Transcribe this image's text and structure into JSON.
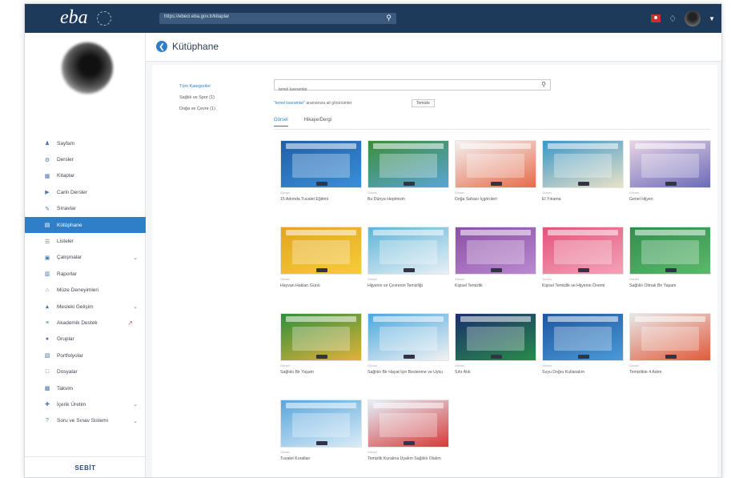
{
  "topbar": {
    "logo": "eba",
    "url": "https://ebeci.eba.gov.tr/kitaplar",
    "icons": [
      "flag-icon",
      "bell-icon",
      "avatar",
      "caret-down-icon"
    ]
  },
  "page": {
    "title": "Kütüphane"
  },
  "sidebar": {
    "items": [
      {
        "label": "Sayfam",
        "icon": "person-icon"
      },
      {
        "label": "Dersler",
        "icon": "gear-icon"
      },
      {
        "label": "Kitaplar",
        "icon": "grid-icon"
      },
      {
        "label": "Canlı Dersler",
        "icon": "video-icon"
      },
      {
        "label": "Sınavlar",
        "icon": "pencil-icon"
      },
      {
        "label": "Kütüphane",
        "icon": "book-icon",
        "active": true
      },
      {
        "label": "Listeler",
        "icon": "list-icon"
      },
      {
        "label": "Çalışmalar",
        "icon": "briefcase-icon",
        "chevron": true
      },
      {
        "label": "Raporlar",
        "icon": "chart-icon"
      },
      {
        "label": "Müze Deneyimleri",
        "icon": "museum-icon"
      },
      {
        "label": "Mesleki Gelişim",
        "icon": "graduation-icon",
        "chevron": true
      },
      {
        "label": "Akademik Destek",
        "icon": "bar-icon",
        "external": true
      },
      {
        "label": "Gruplar",
        "icon": "group-icon"
      },
      {
        "label": "Portfolyolar",
        "icon": "portfolio-icon"
      },
      {
        "label": "Dosyalar",
        "icon": "folder-icon"
      },
      {
        "label": "Takvim",
        "icon": "calendar-icon"
      },
      {
        "label": "İçerik Üretim",
        "icon": "create-icon",
        "chevron": true
      },
      {
        "label": "Soru ve Sınav Sistemi",
        "icon": "question-icon",
        "chevron": true
      }
    ],
    "footer": "SEBİT"
  },
  "categories": {
    "heading": "Tüm Kategoriler",
    "items": [
      "Sağlık ve Spor (1)",
      "Doğa ve Çevre (1)"
    ]
  },
  "search": {
    "value": "temel kavramlar",
    "result_prefix": "\"temel kavramlar\"",
    "result_suffix": "aramanıza ait görünümler",
    "clear_label": "Temizle"
  },
  "tabs": [
    {
      "label": "Görsel",
      "active": true
    },
    {
      "label": "Hikaye/Dergi",
      "active": false
    }
  ],
  "cards": [
    {
      "sub": "Görsel",
      "title": "15 Adımda Tuvalet Eğitimi",
      "c1": "#1f5fa8",
      "c2": "#3a8fd8"
    },
    {
      "sub": "Görsel",
      "title": "Bu Dünya Hepimizin",
      "c1": "#3b8e3a",
      "c2": "#5aa5d6"
    },
    {
      "sub": "Görsel",
      "title": "Doğa Sahası İçgörüleri",
      "c1": "#f2f2f2",
      "c2": "#e76b4a"
    },
    {
      "sub": "Görsel",
      "title": "El Yıkama",
      "c1": "#3a96c9",
      "c2": "#e9e2c8"
    },
    {
      "sub": "Görsel",
      "title": "Genel Hijyen",
      "c1": "#e8d3e6",
      "c2": "#6b6bb8"
    },
    {
      "sub": "Görsel",
      "title": "Hayvan Hakları Günü",
      "c1": "#e3a51e",
      "c2": "#f6cc3a"
    },
    {
      "sub": "Görsel",
      "title": "Hijyenin ve Çevrenin Temizliği",
      "c1": "#5fb4d8",
      "c2": "#e8f1f6"
    },
    {
      "sub": "Görsel",
      "title": "Kişisel Temizlik",
      "c1": "#8b4fa5",
      "c2": "#b98ad0"
    },
    {
      "sub": "Görsel",
      "title": "Kişisel Temizlik ve Hijyenin Önemi",
      "c1": "#e5537a",
      "c2": "#f2a3b8"
    },
    {
      "sub": "Görsel",
      "title": "Sağlıklı Olmak Bir Yaşam",
      "c1": "#2e8f4e",
      "c2": "#5cb86a"
    },
    {
      "sub": "Görsel",
      "title": "Sağlıklı Bir Yaşam",
      "c1": "#2f8f3a",
      "c2": "#e2b23a"
    },
    {
      "sub": "Görsel",
      "title": "Sağlıklı Bir Hayat İçin Beslenme ve Uyku",
      "c1": "#4aa8df",
      "c2": "#f2f2f2"
    },
    {
      "sub": "Görsel",
      "title": "Sıfır Atık",
      "c1": "#1a2f6e",
      "c2": "#2a8a4a"
    },
    {
      "sub": "Görsel",
      "title": "Suyu Doğru Kullanalım",
      "c1": "#1e56a0",
      "c2": "#4a9ad8"
    },
    {
      "sub": "Görsel",
      "title": "Temizlikte 4 Adım",
      "c1": "#e7e7e7",
      "c2": "#e25a3a"
    },
    {
      "sub": "Görsel",
      "title": "Tuvalet Kuralları",
      "c1": "#5aa6dc",
      "c2": "#d9ecf7"
    },
    {
      "sub": "Görsel",
      "title": "Temizlik Kuralına Uyalım Sağlıklı Olalım",
      "c1": "#e3f1fa",
      "c2": "#d83a3a"
    }
  ]
}
